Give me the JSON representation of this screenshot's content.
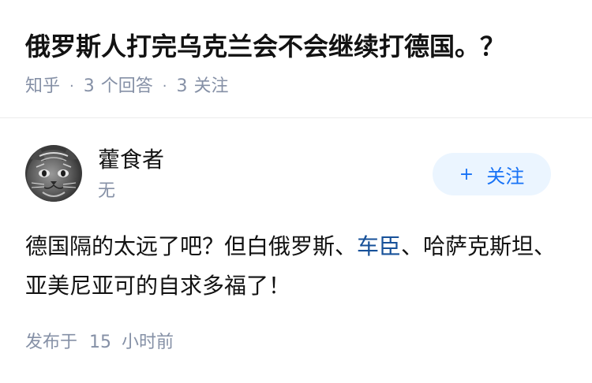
{
  "question": {
    "title": "俄罗斯人打完乌克兰会不会继续打德国。？",
    "source": "知乎",
    "separator": "·",
    "answer_count": "3",
    "answer_label": "个回答",
    "follow_count": "3",
    "follow_label": "关注"
  },
  "answer": {
    "author_name": "藿食者",
    "author_bio": "无",
    "avatar_icon": "cat-avatar-icon",
    "follow_plus": "+",
    "follow_label": "关注",
    "content_part1": "德国隔的太远了吧？但白俄罗斯、",
    "content_link": "车臣",
    "content_part2": "、哈萨克斯坦、亚美尼亚可的自求多福了！",
    "time_prefix": "发布于",
    "time_value": "15",
    "time_suffix": "小时前"
  },
  "colors": {
    "meta_gray": "#8590a6",
    "link_blue": "#175199",
    "follow_blue": "#1772f6",
    "follow_bg": "#ebf5ff"
  }
}
